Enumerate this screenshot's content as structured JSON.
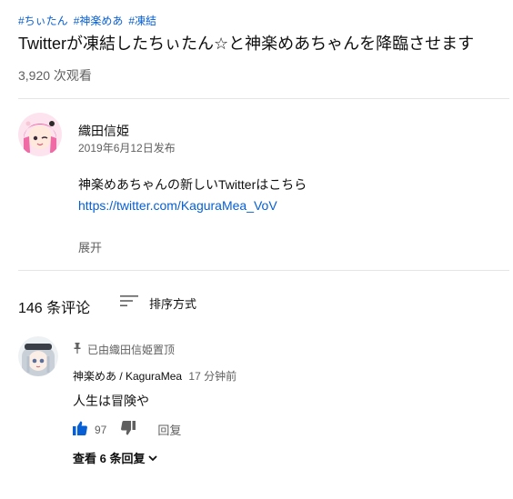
{
  "video": {
    "hashtags": [
      "#ちぃたん",
      "#神楽めあ",
      "#凍結"
    ],
    "title": "Twitterが凍結したちぃたん☆と神楽めあちゃんを降臨させます",
    "views": "3,920 次观看"
  },
  "channel": {
    "name": "織田信姫",
    "publish_date": "2019年6月12日发布"
  },
  "description": {
    "line1": "神楽めあちゃんの新しいTwitterはこちら",
    "link": "https://twitter.com/KaguraMea_VoV",
    "show_more": "展开"
  },
  "comments": {
    "count_label": "146 条评论",
    "sort_label": "排序方式",
    "pinned": {
      "pinned_label": "已由織田信姫置顶",
      "author": "神楽めあ / KaguraMea",
      "time": "17 分钟前",
      "text": "人生は冒険や",
      "likes": "97",
      "reply_label": "回复",
      "view_replies_label": "查看 6 条回复"
    }
  },
  "colors": {
    "link": "#065fd4",
    "like_icon": "#065fd4",
    "secondary_text": "#606060"
  },
  "icons": [
    "sort-icon",
    "pin-icon",
    "thumbs-up-icon",
    "thumbs-down-icon",
    "chevron-down-icon"
  ]
}
